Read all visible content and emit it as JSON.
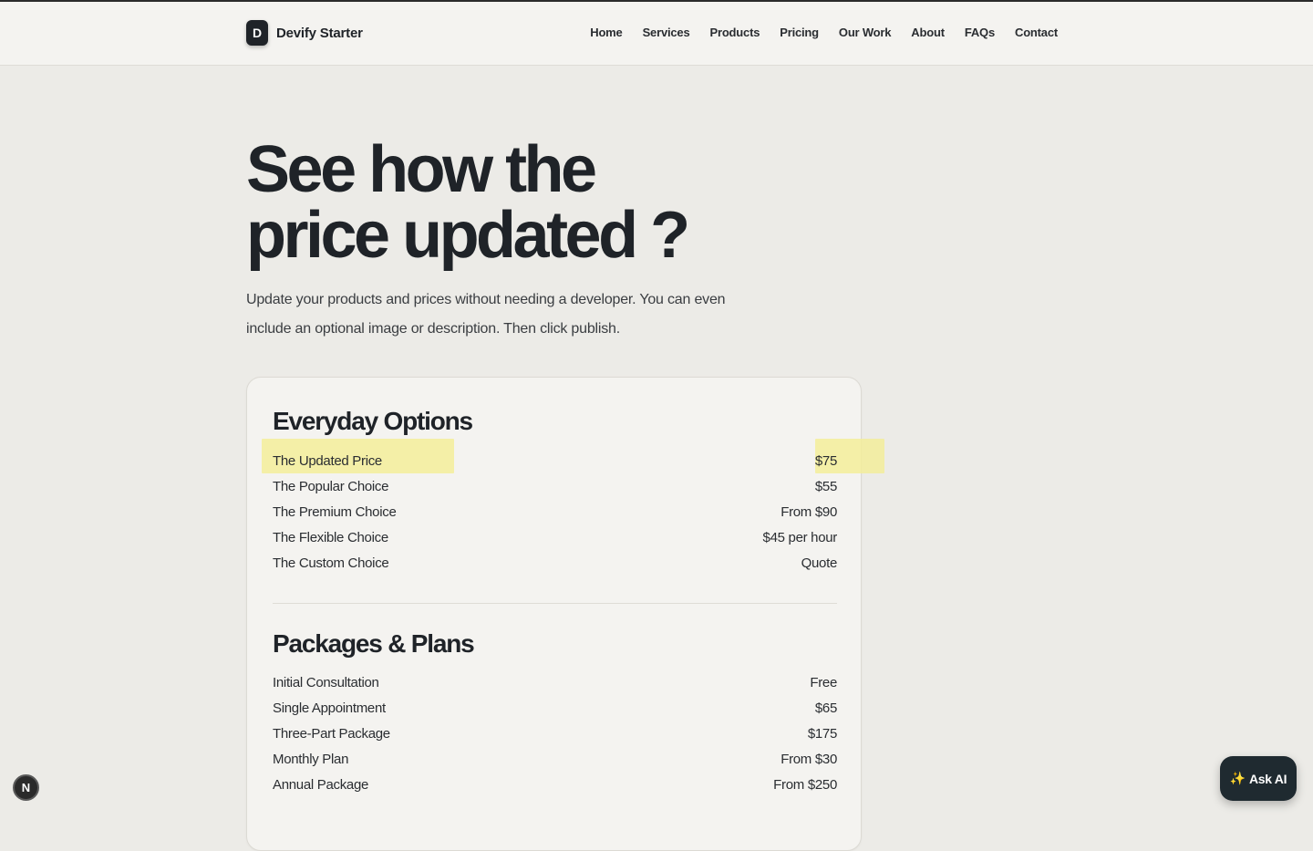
{
  "brand": {
    "logo_letter": "D",
    "name": "Devify Starter"
  },
  "nav": {
    "items": [
      "Home",
      "Services",
      "Products",
      "Pricing",
      "Our Work",
      "About",
      "FAQs",
      "Contact"
    ]
  },
  "hero": {
    "title_line1": "See how the",
    "title_line2": "price updated ?",
    "subtitle": "Update your products and prices without needing a developer. You can even include an optional image or description. Then click publish."
  },
  "pricing": {
    "everyday": {
      "title": "Everyday Options",
      "items": [
        {
          "name": "The Updated Price",
          "price": "$75",
          "highlighted": true
        },
        {
          "name": "The Popular Choice",
          "price": "$55"
        },
        {
          "name": "The Premium Choice",
          "price": "From $90"
        },
        {
          "name": "The Flexible Choice",
          "price": "$45 per hour"
        },
        {
          "name": "The Custom Choice",
          "price": "Quote"
        }
      ]
    },
    "packages": {
      "title": "Packages & Plans",
      "items": [
        {
          "name": "Initial Consultation",
          "price": "Free"
        },
        {
          "name": "Single Appointment",
          "price": "$65"
        },
        {
          "name": "Three-Part Package",
          "price": "$175"
        },
        {
          "name": "Monthly Plan",
          "price": "From $30"
        },
        {
          "name": "Annual Package",
          "price": "From $250"
        }
      ]
    }
  },
  "widgets": {
    "n_badge_letter": "N",
    "ask_ai_label": "Ask AI",
    "ask_ai_icon": "sparkles-icon"
  },
  "colors": {
    "highlight": "#f3ed9a",
    "dark": "#1f2328",
    "background": "#ecebe7"
  }
}
